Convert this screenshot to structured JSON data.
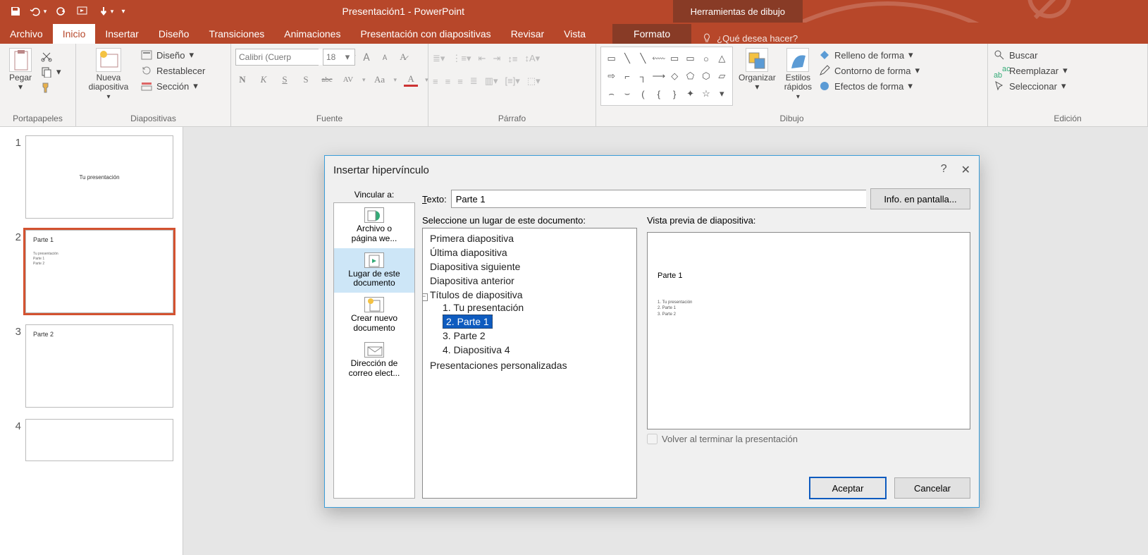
{
  "title": "Presentación1 - PowerPoint",
  "tool_context_tab": "Herramientas de dibujo",
  "tabs": {
    "file": "Archivo",
    "home": "Inicio",
    "insert": "Insertar",
    "design": "Diseño",
    "transitions": "Transiciones",
    "animations": "Animaciones",
    "slideshow": "Presentación con diapositivas",
    "review": "Revisar",
    "view": "Vista",
    "format": "Formato",
    "tellme": "¿Qué desea hacer?"
  },
  "ribbon": {
    "clipboard": {
      "paste": "Pegar",
      "label": "Portapapeles"
    },
    "slides": {
      "newslide": "Nueva\ndiapositiva",
      "layout": "Diseño",
      "reset": "Restablecer",
      "section": "Sección",
      "label": "Diapositivas"
    },
    "font": {
      "name": "Calibri (Cuerp",
      "size": "18",
      "bold": "N",
      "italic": "K",
      "underline": "S",
      "shadow": "S",
      "strike": "abc",
      "spacing": "AV",
      "case": "Aa",
      "color": "A",
      "label": "Fuente"
    },
    "paragraph": {
      "label": "Párrafo"
    },
    "drawing": {
      "arrange": "Organizar",
      "styles": "Estilos\nrápidos",
      "fill": "Relleno de forma",
      "outline": "Contorno de forma",
      "effects": "Efectos de forma",
      "label": "Dibujo"
    },
    "editing": {
      "find": "Buscar",
      "replace": "Reemplazar",
      "select": "Seleccionar",
      "label": "Edición"
    }
  },
  "thumbs": [
    {
      "num": "1",
      "title": "Tu presentación",
      "items": ""
    },
    {
      "num": "2",
      "title": "Parte 1",
      "items": "Tu presentación\nParte 1\nParte 2"
    },
    {
      "num": "3",
      "title": "Parte 2",
      "items": ""
    },
    {
      "num": "4",
      "title": "",
      "items": ""
    }
  ],
  "dialog": {
    "title": "Insertar hipervínculo",
    "linkto_label": "Vincular a:",
    "linkto": [
      {
        "id": "archivo",
        "l1": "Archivo o",
        "l2": "página we..."
      },
      {
        "id": "lugar",
        "l1": "Lugar de este",
        "l2": "documento"
      },
      {
        "id": "crear",
        "l1": "Crear nuevo",
        "l2": "documento"
      },
      {
        "id": "correo",
        "l1": "Dirección de",
        "l2": "correo elect..."
      }
    ],
    "text_label": "Texto:",
    "text_value": "Parte 1",
    "screentip": "Info. en pantalla...",
    "select_label": "Seleccione un lugar de este documento:",
    "preview_label": "Vista previa de diapositiva:",
    "tree": {
      "first": "Primera diapositiva",
      "last": "Última diapositiva",
      "next": "Diapositiva siguiente",
      "prev": "Diapositiva anterior",
      "titles": "Títulos de diapositiva",
      "items": [
        "1. Tu presentación",
        "2. Parte 1",
        "3. Parte 2",
        "4. Diapositiva 4"
      ],
      "custom": "Presentaciones personalizadas"
    },
    "preview": {
      "title": "Parte 1",
      "items": [
        "1.  Tu presentación",
        "2.  Parte 1",
        "3.  Parte 2"
      ]
    },
    "return_check": "Volver al terminar la presentación",
    "ok": "Aceptar",
    "cancel": "Cancelar"
  }
}
